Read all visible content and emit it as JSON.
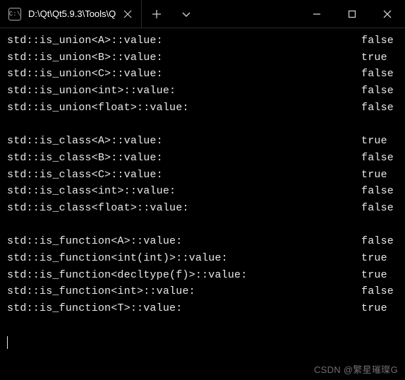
{
  "titlebar": {
    "tab_title": "D:\\Qt\\Qt5.9.3\\Tools\\Q",
    "tab_icon_label": "C:\\"
  },
  "output": {
    "group1": [
      {
        "label": "std::is_union<A>::value:",
        "value": "false"
      },
      {
        "label": "std::is_union<B>::value:",
        "value": "true"
      },
      {
        "label": "std::is_union<C>::value:",
        "value": "false"
      },
      {
        "label": "std::is_union<int>::value:",
        "value": "false"
      },
      {
        "label": "std::is_union<float>::value:",
        "value": "false"
      }
    ],
    "group2": [
      {
        "label": "std::is_class<A>::value:",
        "value": "true"
      },
      {
        "label": "std::is_class<B>::value:",
        "value": "false"
      },
      {
        "label": "std::is_class<C>::value:",
        "value": "true"
      },
      {
        "label": "std::is_class<int>::value:",
        "value": "false"
      },
      {
        "label": "std::is_class<float>::value:",
        "value": "false"
      }
    ],
    "group3": [
      {
        "label": "std::is_function<A>::value:",
        "value": "false"
      },
      {
        "label": "std::is_function<int(int)>::value:",
        "value": "true"
      },
      {
        "label": "std::is_function<decltype(f)>::value:",
        "value": "true"
      },
      {
        "label": "std::is_function<int>::value:",
        "value": "false"
      },
      {
        "label": "std::is_function<T>::value:",
        "value": "true"
      }
    ]
  },
  "watermark": "CSDN @繁星璀璨G"
}
